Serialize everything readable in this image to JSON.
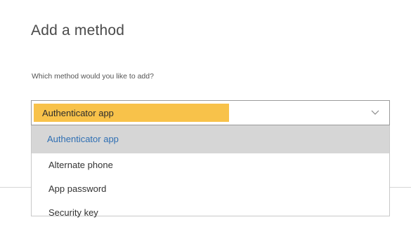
{
  "dialog": {
    "title": "Add a method",
    "prompt": "Which method would you like to add?"
  },
  "method_select": {
    "selected_value": "Authenticator app",
    "options": [
      {
        "label": "Authenticator app",
        "selected": true
      },
      {
        "label": "Alternate phone",
        "selected": false
      },
      {
        "label": "App password",
        "selected": false
      },
      {
        "label": "Security key",
        "selected": false
      }
    ]
  },
  "colors": {
    "highlight": "#f8c24a",
    "selected_option_bg": "#d6d6d6",
    "selected_option_text": "#2f6fb3"
  },
  "icons": {
    "dropdown": "chevron-down-icon"
  }
}
